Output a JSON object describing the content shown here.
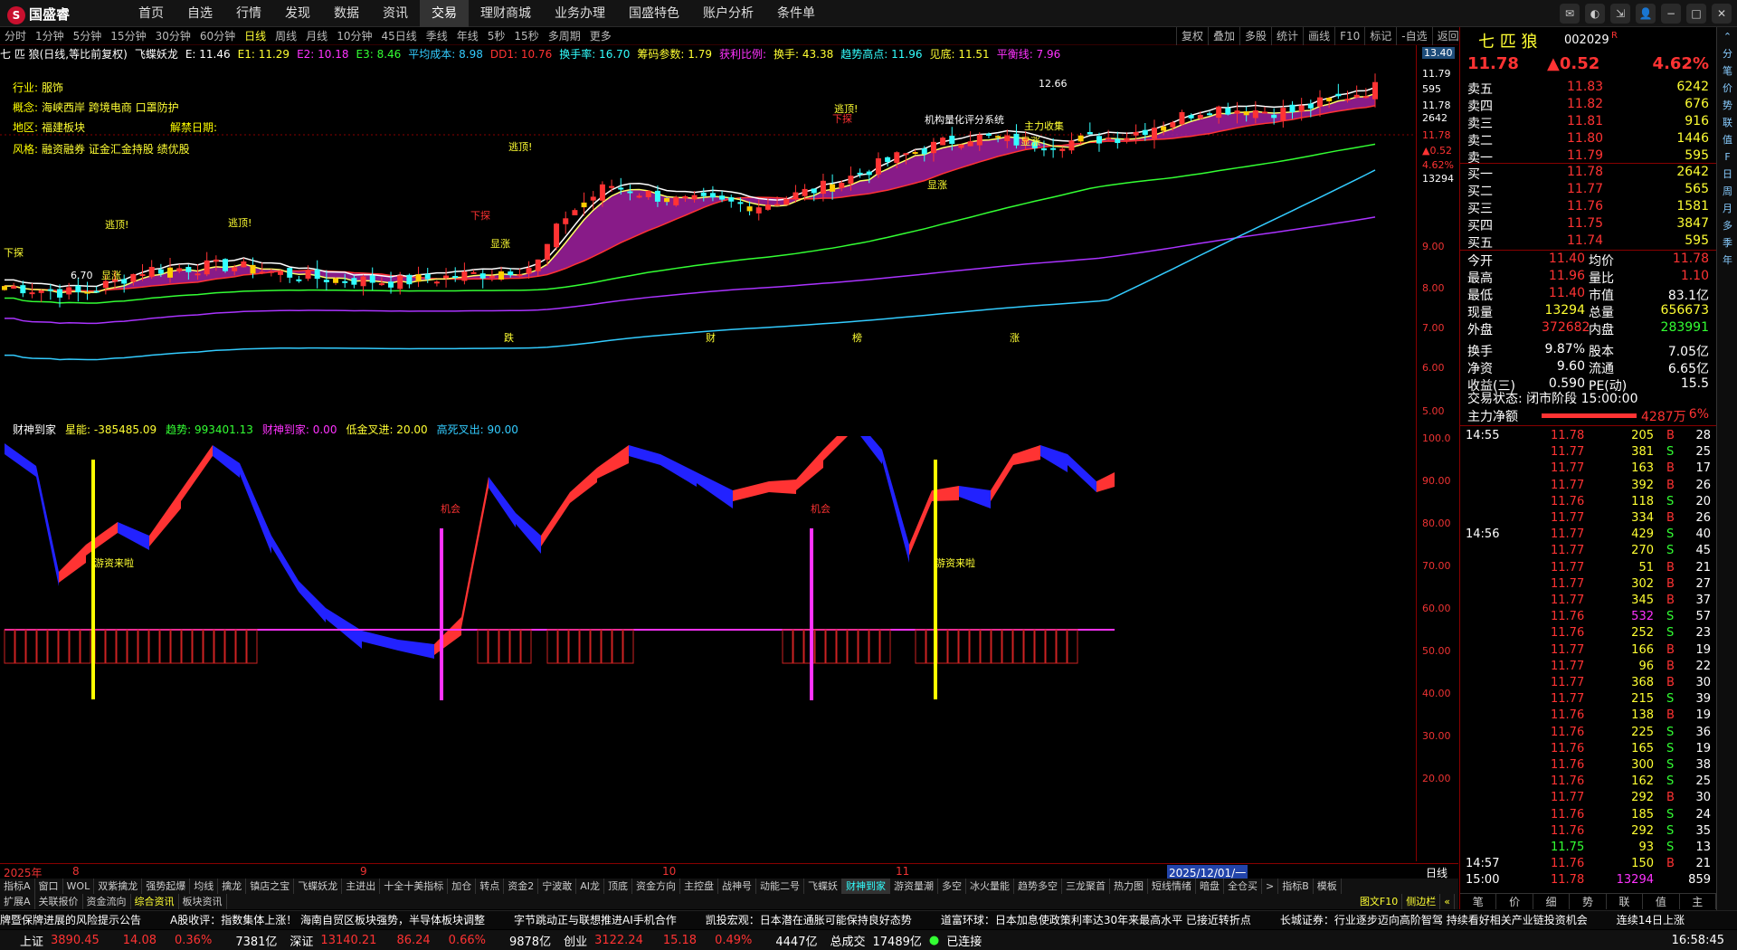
{
  "app": {
    "logo_text": "国盛睿"
  },
  "menu": [
    "首页",
    "自选",
    "行情",
    "发现",
    "数据",
    "资讯",
    "交易",
    "理财商城",
    "业务办理",
    "国盛特色",
    "账户分析",
    "条件单"
  ],
  "menu_active_index": 6,
  "window_controls": [
    "message-icon",
    "skin-icon",
    "shrink-icon",
    "user-icon",
    "minimize-icon",
    "maximize-icon",
    "close-icon"
  ],
  "periods": [
    "分时",
    "1分钟",
    "5分钟",
    "15分钟",
    "30分钟",
    "60分钟",
    "日线",
    "周线",
    "月线",
    "10分钟",
    "45日线",
    "季线",
    "年线",
    "5秒",
    "15秒",
    "多周期",
    "更多"
  ],
  "period_active_index": 6,
  "chart_tools": [
    "复权",
    "叠加",
    "多股",
    "统计",
    "画线",
    "F10",
    "标记",
    "-自选",
    "返回"
  ],
  "stock_line": [
    {
      "text": "七 匹 狼(日线,等比前复权)",
      "color": "#ffffff"
    },
    {
      "text": "飞蝶妖龙",
      "color": "#ffffff"
    },
    {
      "text": "E: 11.46",
      "color": "#ffffff"
    },
    {
      "text": "E1: 11.29",
      "color": "#ffff33"
    },
    {
      "text": "E2: 10.18",
      "color": "#ff33ff"
    },
    {
      "text": "E3: 8.46",
      "color": "#33ff33"
    },
    {
      "text": "平均成本: 8.98",
      "color": "#33ccff"
    },
    {
      "text": "DD1: 10.76",
      "color": "#ff3333"
    },
    {
      "text": "换手率: 16.70",
      "color": "#33ffff"
    },
    {
      "text": "筹码参数: 1.79",
      "color": "#ffff33"
    },
    {
      "text": "获利比例:",
      "color": "#ff33ff"
    },
    {
      "text": "换手: 43.38",
      "color": "#ffff33"
    },
    {
      "text": "趋势高点: 11.96",
      "color": "#33ffff"
    },
    {
      "text": "见底: 11.51",
      "color": "#ffff33"
    },
    {
      "text": "平衡线: 7.96",
      "color": "#ff33ff"
    }
  ],
  "info": {
    "industry_label": "行业:",
    "industry": "服饰",
    "concept_label": "概念:",
    "concept": "海峡西岸 跨境电商 口罩防护",
    "region_label": "地区:",
    "region": "福建板块",
    "unlock_label": "解禁日期:",
    "style_label": "风格:",
    "style": "融资融券 证金汇金持股 绩优股"
  },
  "chart_annotations": [
    {
      "text": "下探"
    },
    {
      "text": "逃顶!"
    },
    {
      "text": "逃顶!"
    },
    {
      "text": "6.70"
    },
    {
      "text": "显涨"
    },
    {
      "text": "逃顶!"
    },
    {
      "text": "下探"
    },
    {
      "text": "显涨"
    },
    {
      "text": "逃顶!"
    },
    {
      "text": "下探"
    },
    {
      "text": "机构量化评分系统"
    },
    {
      "text": "显涨"
    },
    {
      "text": "显涨"
    },
    {
      "text": "12.66"
    },
    {
      "text": "主力收集"
    },
    {
      "text": "跌"
    },
    {
      "text": "财"
    },
    {
      "text": "榜"
    },
    {
      "text": "涨"
    }
  ],
  "indicator_header": [
    {
      "text": "财神到家",
      "color": "#ffffff"
    },
    {
      "text": "星能: -385485.09",
      "color": "#ffff33"
    },
    {
      "text": "趋势: 993401.13",
      "color": "#33ff33"
    },
    {
      "text": "财神到家: 0.00",
      "color": "#ff33ff"
    },
    {
      "text": "低金叉进: 20.00",
      "color": "#ffff33"
    },
    {
      "text": "高死叉出: 90.00",
      "color": "#33ccff"
    }
  ],
  "indicator_annotations": [
    "游资来啦",
    "机会",
    "机会",
    "游资来啦"
  ],
  "price_axis_top": [
    "13.40",
    "11.79",
    "595",
    "11.78",
    "2642",
    "11.78",
    "▲0.52",
    "4.62%",
    "13294"
  ],
  "price_axis": [
    "9.00",
    "8.00",
    "7.00",
    "6.00",
    "5.00"
  ],
  "ind_axis": [
    "100.0",
    "90.00",
    "80.00",
    "70.00",
    "60.00",
    "50.00",
    "40.00",
    "30.00",
    "20.00"
  ],
  "date_axis": [
    "2025年",
    "8",
    "9",
    "10",
    "11",
    "2025/12/01/一",
    "日线"
  ],
  "bottom_tabs1": [
    "指标A",
    "窗口",
    "WOL",
    "双紫擒龙",
    "强势起爆",
    "均线",
    "擒龙",
    "镇店之宝",
    "飞蝶妖龙",
    "主进出",
    "十全十美指标",
    "加仓",
    "转点",
    "资金2",
    "宁波敢",
    "AI龙",
    "顶底",
    "资金方向",
    "主控盘",
    "战神号",
    "动能二号",
    "飞蝶妖",
    "财神到家",
    "游资量潮",
    "多空",
    "冰火量能",
    "趋势多空",
    "三龙聚首",
    "热力图",
    "短线情绪",
    "暗盘",
    "全仓买",
    ">",
    "指标B",
    "模板"
  ],
  "bottom_tabs2": [
    "扩展A",
    "关联报价",
    "资金流向",
    "综合资讯",
    "板块资讯"
  ],
  "bottom_tabs_right": [
    "图文F10",
    "侧边栏",
    "«"
  ],
  "news": [
    "牌暨保牌进展的风险提示公告",
    "A股收评：指数集体上涨！ 海南自贸区板块强势，半导体板块调整",
    "字节跳动正与联想推进AI手机合作",
    "凯投宏观：日本潜在通胀可能保持良好态势",
    "道富环球：日本加息使政策利率达30年来最高水平 已接近转折点",
    "长城证券：行业逐步迈向高阶智驾 持续看好相关产业链投资机会",
    "连续14日上涨"
  ],
  "status": {
    "sh": "上证",
    "sh_val": "3890.45",
    "sh_chg": "14.08",
    "sh_pct": "0.36%",
    "sh_amt": "7381亿",
    "sz": "深证",
    "sz_val": "13140.21",
    "sz_chg": "86.24",
    "sz_pct": "0.66%",
    "sz_amt": "9878亿",
    "cy": "创业",
    "cy_val": "3122.24",
    "cy_chg": "15.18",
    "cy_pct": "0.49%",
    "cy_amt": "4447亿",
    "total_lbl": "总成交",
    "total": "17489亿",
    "conn": "已连接",
    "time": "16:58:45"
  },
  "quote": {
    "name": "七 匹 狼",
    "code": "002029",
    "mark": "R",
    "price": "11.78",
    "change": "▲0.52",
    "pct": "4.62%",
    "asks": [
      {
        "l": "卖五",
        "p": "11.83",
        "v": "6242"
      },
      {
        "l": "卖四",
        "p": "11.82",
        "v": "676"
      },
      {
        "l": "卖三",
        "p": "11.81",
        "v": "916"
      },
      {
        "l": "卖二",
        "p": "11.80",
        "v": "1446"
      },
      {
        "l": "卖一",
        "p": "11.79",
        "v": "595"
      }
    ],
    "bids": [
      {
        "l": "买一",
        "p": "11.78",
        "v": "2642"
      },
      {
        "l": "买二",
        "p": "11.77",
        "v": "565"
      },
      {
        "l": "买三",
        "p": "11.76",
        "v": "1581"
      },
      {
        "l": "买四",
        "p": "11.75",
        "v": "3847"
      },
      {
        "l": "买五",
        "p": "11.74",
        "v": "595"
      }
    ],
    "stats": [
      [
        "今开",
        "11.40",
        "均价",
        "11.78"
      ],
      [
        "最高",
        "11.96",
        "量比",
        "1.10"
      ],
      [
        "最低",
        "11.40",
        "市值",
        "83.1亿"
      ],
      [
        "现量",
        "13294",
        "总量",
        "656673"
      ],
      [
        "外盘",
        "372682",
        "内盘",
        "283991"
      ],
      [
        "换手",
        "9.87%",
        "股本",
        "7.05亿"
      ],
      [
        "净资",
        "9.60",
        "流通",
        "6.65亿"
      ],
      [
        "收益(三)",
        "0.590",
        "PE(动)",
        "15.5"
      ]
    ],
    "trade_state": "交易状态: 闭市阶段 15:00:00",
    "net_label": "主力净额",
    "net_val": "4287万",
    "net_pct": "6%"
  },
  "ticks": [
    {
      "t": "14:55",
      "p": "11.78",
      "v": "205",
      "d": "B",
      "n": "28"
    },
    {
      "t": "",
      "p": "11.77",
      "v": "381",
      "d": "S",
      "n": "25"
    },
    {
      "t": "",
      "p": "11.77",
      "v": "163",
      "d": "B",
      "n": "17"
    },
    {
      "t": "",
      "p": "11.77",
      "v": "392",
      "d": "B",
      "n": "26"
    },
    {
      "t": "",
      "p": "11.76",
      "v": "118",
      "d": "S",
      "n": "20"
    },
    {
      "t": "",
      "p": "11.77",
      "v": "334",
      "d": "B",
      "n": "26"
    },
    {
      "t": "14:56",
      "p": "11.77",
      "v": "429",
      "d": "S",
      "n": "40"
    },
    {
      "t": "",
      "p": "11.77",
      "v": "270",
      "d": "S",
      "n": "45"
    },
    {
      "t": "",
      "p": "11.77",
      "v": "51",
      "d": "B",
      "n": "21"
    },
    {
      "t": "",
      "p": "11.77",
      "v": "302",
      "d": "B",
      "n": "27"
    },
    {
      "t": "",
      "p": "11.77",
      "v": "345",
      "d": "B",
      "n": "37"
    },
    {
      "t": "",
      "p": "11.76",
      "v": "532",
      "d": "S",
      "n": "57"
    },
    {
      "t": "",
      "p": "11.76",
      "v": "252",
      "d": "S",
      "n": "23"
    },
    {
      "t": "",
      "p": "11.77",
      "v": "166",
      "d": "B",
      "n": "19"
    },
    {
      "t": "",
      "p": "11.77",
      "v": "96",
      "d": "B",
      "n": "22"
    },
    {
      "t": "",
      "p": "11.77",
      "v": "368",
      "d": "B",
      "n": "30"
    },
    {
      "t": "",
      "p": "11.77",
      "v": "215",
      "d": "S",
      "n": "39"
    },
    {
      "t": "",
      "p": "11.76",
      "v": "138",
      "d": "B",
      "n": "19"
    },
    {
      "t": "",
      "p": "11.76",
      "v": "225",
      "d": "S",
      "n": "36"
    },
    {
      "t": "",
      "p": "11.76",
      "v": "165",
      "d": "S",
      "n": "19"
    },
    {
      "t": "",
      "p": "11.76",
      "v": "300",
      "d": "S",
      "n": "38"
    },
    {
      "t": "",
      "p": "11.76",
      "v": "162",
      "d": "S",
      "n": "25"
    },
    {
      "t": "",
      "p": "11.77",
      "v": "292",
      "d": "B",
      "n": "30"
    },
    {
      "t": "",
      "p": "11.76",
      "v": "185",
      "d": "S",
      "n": "24"
    },
    {
      "t": "",
      "p": "11.76",
      "v": "292",
      "d": "S",
      "n": "35"
    },
    {
      "t": "",
      "p": "11.75",
      "v": "93",
      "d": "S",
      "n": "13"
    },
    {
      "t": "14:57",
      "p": "11.76",
      "v": "150",
      "d": "B",
      "n": "21"
    },
    {
      "t": "15:00",
      "p": "11.78",
      "v": "13294",
      "d": "",
      "n": "859"
    }
  ],
  "right_tabs": [
    "笔",
    "价",
    "细",
    "势",
    "联",
    "值",
    "主"
  ],
  "sidebar_items": [
    "⌃",
    "分",
    "笔",
    "价",
    "势",
    "联",
    "值",
    "F",
    "日",
    "周",
    "月",
    "多",
    "季",
    "年"
  ],
  "colors": {
    "up": "#ff3333",
    "down": "#33ff33",
    "gold": "#ffff33",
    "magenta": "#ff33ff",
    "cyan": "#33ccff"
  }
}
